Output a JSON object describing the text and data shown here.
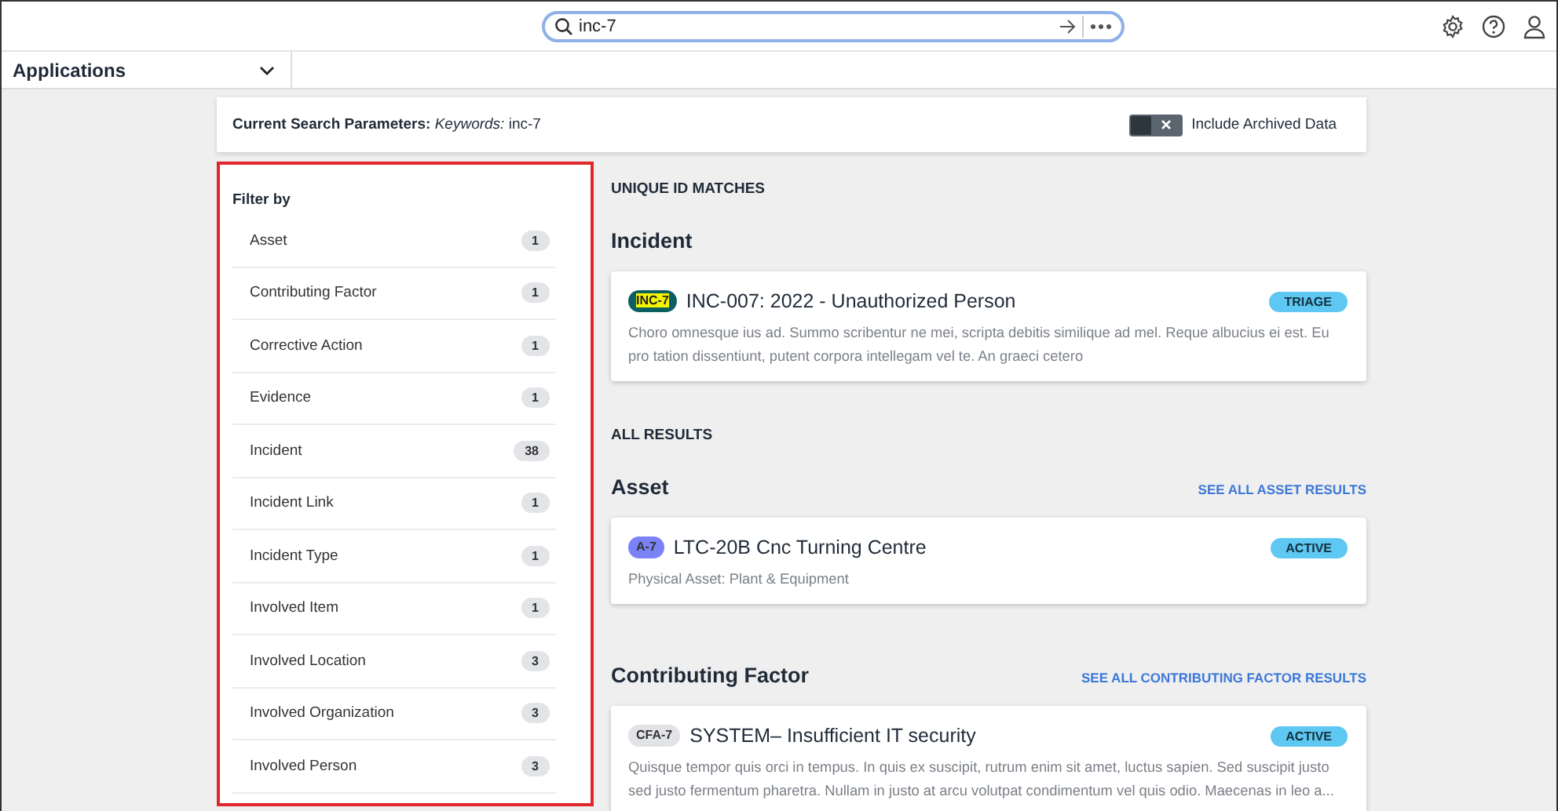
{
  "search": {
    "value": "inc-7"
  },
  "app_menu": {
    "label": "Applications"
  },
  "search_parameters": {
    "label": "Current Search Parameters:",
    "keyword_label": "Keywords:",
    "keyword": "inc-7"
  },
  "include_archived": {
    "label": "Include Archived Data",
    "on": false
  },
  "filter": {
    "title": "Filter by",
    "items": [
      {
        "label": "Asset",
        "count": "1"
      },
      {
        "label": "Contributing Factor",
        "count": "1"
      },
      {
        "label": "Corrective Action",
        "count": "1"
      },
      {
        "label": "Evidence",
        "count": "1"
      },
      {
        "label": "Incident",
        "count": "38"
      },
      {
        "label": "Incident Link",
        "count": "1"
      },
      {
        "label": "Incident Type",
        "count": "1"
      },
      {
        "label": "Involved Item",
        "count": "1"
      },
      {
        "label": "Involved Location",
        "count": "3"
      },
      {
        "label": "Involved Organization",
        "count": "3"
      },
      {
        "label": "Involved Person",
        "count": "3"
      }
    ]
  },
  "sections": [
    {
      "heading": "UNIQUE ID MATCHES",
      "groups": [
        {
          "title": "Incident",
          "cards": [
            {
              "id": "INC-7",
              "color": "#0d5e63",
              "highlighted": true,
              "title": "INC-007: 2022 - Unauthorized Person",
              "status": "TRIAGE",
              "description": "Choro omnesque ius ad. Summo scribentur ne mei, scripta debitis similique ad mel. Reque albucius ei est. Eu pro tation dissentiunt, putent corpora intellegam vel te. An graeci cetero"
            }
          ]
        }
      ]
    },
    {
      "heading": "ALL RESULTS",
      "groups": [
        {
          "title": "Asset",
          "link": "SEE ALL ASSET RESULTS",
          "cards": [
            {
              "id": "A-7",
              "color": "#7b82f5",
              "highlighted": false,
              "title": "LTC-20B Cnc Turning Centre",
              "status": "ACTIVE",
              "description": "Physical Asset: Plant & Equipment"
            }
          ]
        },
        {
          "title": "Contributing Factor",
          "link": "SEE ALL CONTRIBUTING FACTOR RESULTS",
          "cards": [
            {
              "id": "CFA-7",
              "color": "#e1e3e6",
              "highlighted": false,
              "title": "SYSTEM– Insufficient IT security",
              "status": "ACTIVE",
              "description": "Quisque tempor quis orci in tempus. In quis ex suscipit, rutrum enim sit amet, luctus sapien. Sed suscipit justo sed justo fermentum pharetra. Nullam in justo at arcu volutpat condimentum vel quis odio. Maecenas in leo a..."
            }
          ]
        }
      ]
    }
  ]
}
